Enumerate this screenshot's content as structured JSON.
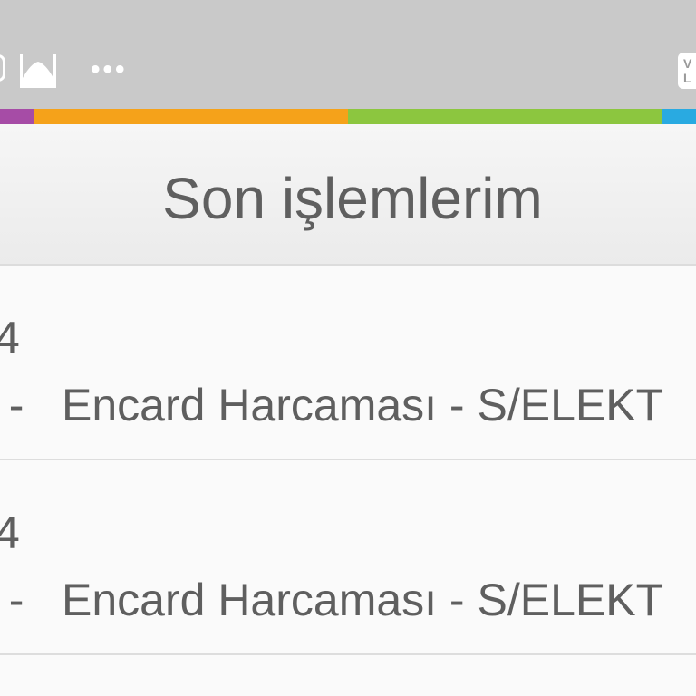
{
  "status_bar": {
    "left_icons": [
      "mosque-icon",
      "more-icon"
    ],
    "more_text": "•••",
    "right_badge": "V\nL"
  },
  "color_strip": [
    {
      "color": "#a64ca6",
      "share": 0.05
    },
    {
      "color": "#f5a21a",
      "share": 0.45
    },
    {
      "color": "#8cc63f",
      "share": 0.45
    },
    {
      "color": "#29aae1",
      "share": 0.05
    }
  ],
  "header": {
    "title": "Son işlemlerim"
  },
  "transactions": [
    {
      "date": "4",
      "amount": ". -",
      "description": "Encard Harcaması - S/ELEKT"
    },
    {
      "date": "4",
      "amount": ". -",
      "description": "Encard Harcaması - S/ELEKT"
    }
  ]
}
